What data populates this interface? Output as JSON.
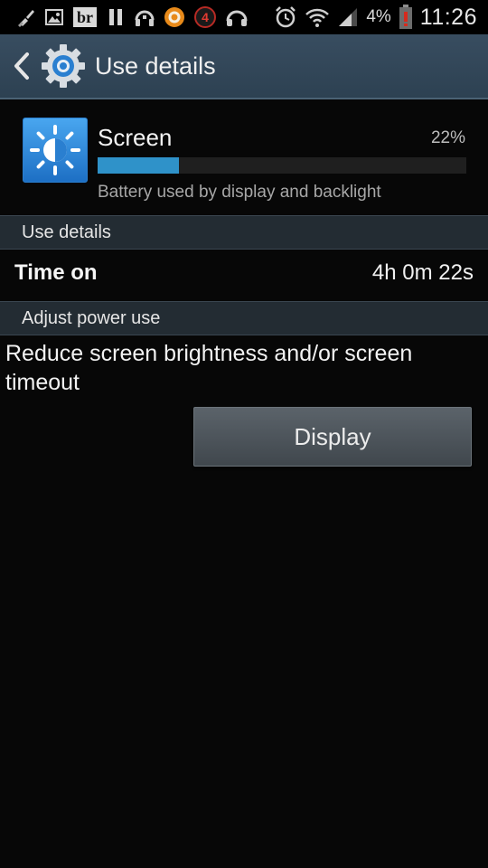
{
  "status_bar": {
    "left_icons": [
      "broom-cleaner-icon",
      "image-icon",
      "br-badge-icon",
      "pause-icon",
      "headphones-icon",
      "orange-circle-app-icon",
      "red-number-4-icon",
      "headset-icon"
    ],
    "right_icons": [
      "alarm-clock-icon",
      "wifi-icon",
      "cell-signal-icon",
      "battery-low-icon"
    ],
    "br_text": "br",
    "badge_number": "4",
    "battery_percent": "4%",
    "time": "11:26"
  },
  "action_bar": {
    "title": "Use details"
  },
  "usage": {
    "name": "Screen",
    "percent_label": "22%",
    "percent_value": 0.22,
    "description": "Battery used by display and backlight"
  },
  "sections": {
    "use_details_header": "Use details",
    "adjust_power_header": "Adjust power use"
  },
  "time_on": {
    "label": "Time on",
    "value": "4h 0m 22s"
  },
  "advice": {
    "text": "Reduce screen brightness and/or screen timeout"
  },
  "display_button": {
    "label": "Display"
  },
  "colors": {
    "action_bar": "#33475a",
    "bar_fill": "#2f92c9",
    "app_icon": "#2d86d8",
    "section_header": "#232c33",
    "background": "#070707"
  }
}
